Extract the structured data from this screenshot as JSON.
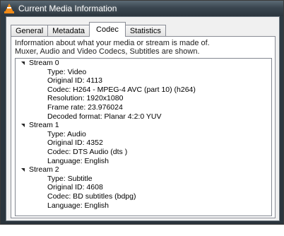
{
  "window": {
    "title": "Current Media Information"
  },
  "tabs": [
    {
      "label": "General",
      "active": false
    },
    {
      "label": "Metadata",
      "active": false
    },
    {
      "label": "Codec",
      "active": true
    },
    {
      "label": "Statistics",
      "active": false
    }
  ],
  "codec_panel": {
    "info_line1": "Information about what your media or stream is made of.",
    "info_line2": "Muxer, Audio and Video Codecs, Subtitles are shown."
  },
  "streams": [
    {
      "label": "Stream 0",
      "items": [
        "Type: Video",
        "Original ID: 4113",
        "Codec: H264 - MPEG-4 AVC (part 10) (h264)",
        "Resolution: 1920x1080",
        "Frame rate: 23.976024",
        "Decoded format: Planar 4:2:0 YUV"
      ]
    },
    {
      "label": "Stream 1",
      "items": [
        "Type: Audio",
        "Original ID: 4352",
        "Codec: DTS Audio (dts )",
        "Language: English"
      ]
    },
    {
      "label": "Stream 2",
      "items": [
        "Type: Subtitle",
        "Original ID: 4608",
        "Codec: BD subtitles (bdpg)",
        "Language: English"
      ]
    }
  ]
}
